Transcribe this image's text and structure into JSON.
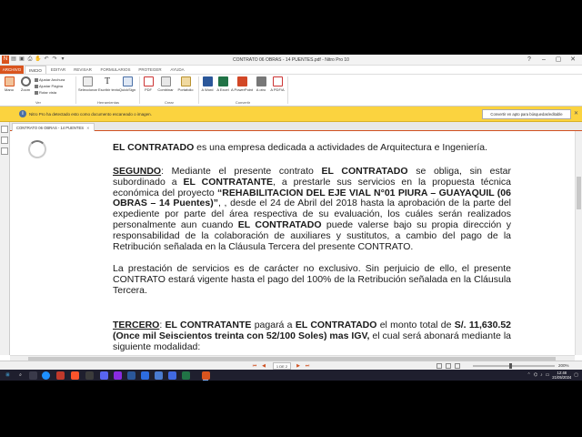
{
  "window": {
    "title": "CONTRATO 06 OBRAS - 14 PUENTES.pdf - Nitro Pro 10"
  },
  "ribbon": {
    "tabs": [
      "ARCHIVO",
      "INICIO",
      "EDITAR",
      "REVISAR",
      "FORMULARIOS",
      "PROTEGER",
      "AYUDA"
    ],
    "buttons": {
      "mano": "Mano",
      "zoom": "Zoom",
      "ajustar_anchura": "Ajustar Anchura",
      "ajustar_pagina": "Ajustar Página",
      "rotar_vista": "Rotar vista",
      "seleccionar": "Seleccionar",
      "escribir_texto": "Escribir texto",
      "quicksign": "QuickSign",
      "pdf": "PDF",
      "combinar": "Combinar",
      "portafolio": "Portafolio",
      "a_word": "A Word",
      "a_excel": "A Excel",
      "a_powerpoint": "A PowerPoint",
      "a_otro": "A otro",
      "a_pdfa": "A PDF/A"
    },
    "groups": {
      "ver": "Ver",
      "herramientas": "Herramientas",
      "crear": "Crear",
      "convertir": "Convertir"
    }
  },
  "notification": {
    "message": "Nitro Pro ha detectado esto como documento escaneado o imagen.",
    "action": "Convertir en apto para búsquedas/editable"
  },
  "document_tab": {
    "label": "CONTRATO 06 OBRAS - 14 PUENTES"
  },
  "document": {
    "p1_bold": "EL CONTRATADO",
    "p1_rest": " es una empresa dedicada a actividades de Arquitectura e Ingeniería.",
    "p2_heading": "SEGUNDO",
    "p2_a": ":   Mediante el presente contrato ",
    "p2_b": "EL CONTRATADO",
    "p2_c": " se obliga, sin estar subordinado a ",
    "p2_d": "EL CONTRATANTE",
    "p2_e": ", a prestarle sus servicios en la propuesta técnica económica del proyecto ",
    "p2_f": "“REHABILITACION DEL EJE VIAL N°01 PIURA – GUAYAQUIL (06 OBRAS – 14 Puentes)”",
    "p2_g": ", , desde el 24 de Abril del 2018 hasta la aprobación de la parte del expediente por parte del área respectiva de su evaluación, los cuáles serán realizados personalmente aun cuando ",
    "p2_h": "EL CONTRATADO",
    "p2_i": " puede valerse bajo su propia dirección y responsabilidad de la colaboración de auxiliares y sustitutos, a cambio del pago de la Retribución señalada en la Cláusula Tercera del presente CONTRATO.",
    "p3_a": "La prestación de servicios es de carácter no exclusivo. Sin perjuicio de ello, el presente ",
    "p3_b": "CONTRATO estará vigente hasta el pago del 100% de la Retribución señalada en la Cláusula Tercera.",
    "p4_heading": "TERCERO",
    "p4_a": ":   ",
    "p4_b": "EL CONTRATANTE",
    "p4_c": " pagará a ",
    "p4_d": "EL CONTRATADO",
    "p4_e": " el monto total de ",
    "p4_f": "S/. 11,630.52 (Once mil Seiscientos treinta con 52/100 Soles) mas IGV,",
    "p4_g": " el cual será abonará mediante la siguiente modalidad:"
  },
  "statusbar": {
    "page": "1 DE 2",
    "zoom": "200%"
  },
  "taskbar": {
    "time": "12:48",
    "date": "21/05/2024"
  },
  "colors": {
    "accent": "#d9541e",
    "notification": "#fbd33f",
    "taskbar": "#1f1f2e"
  }
}
